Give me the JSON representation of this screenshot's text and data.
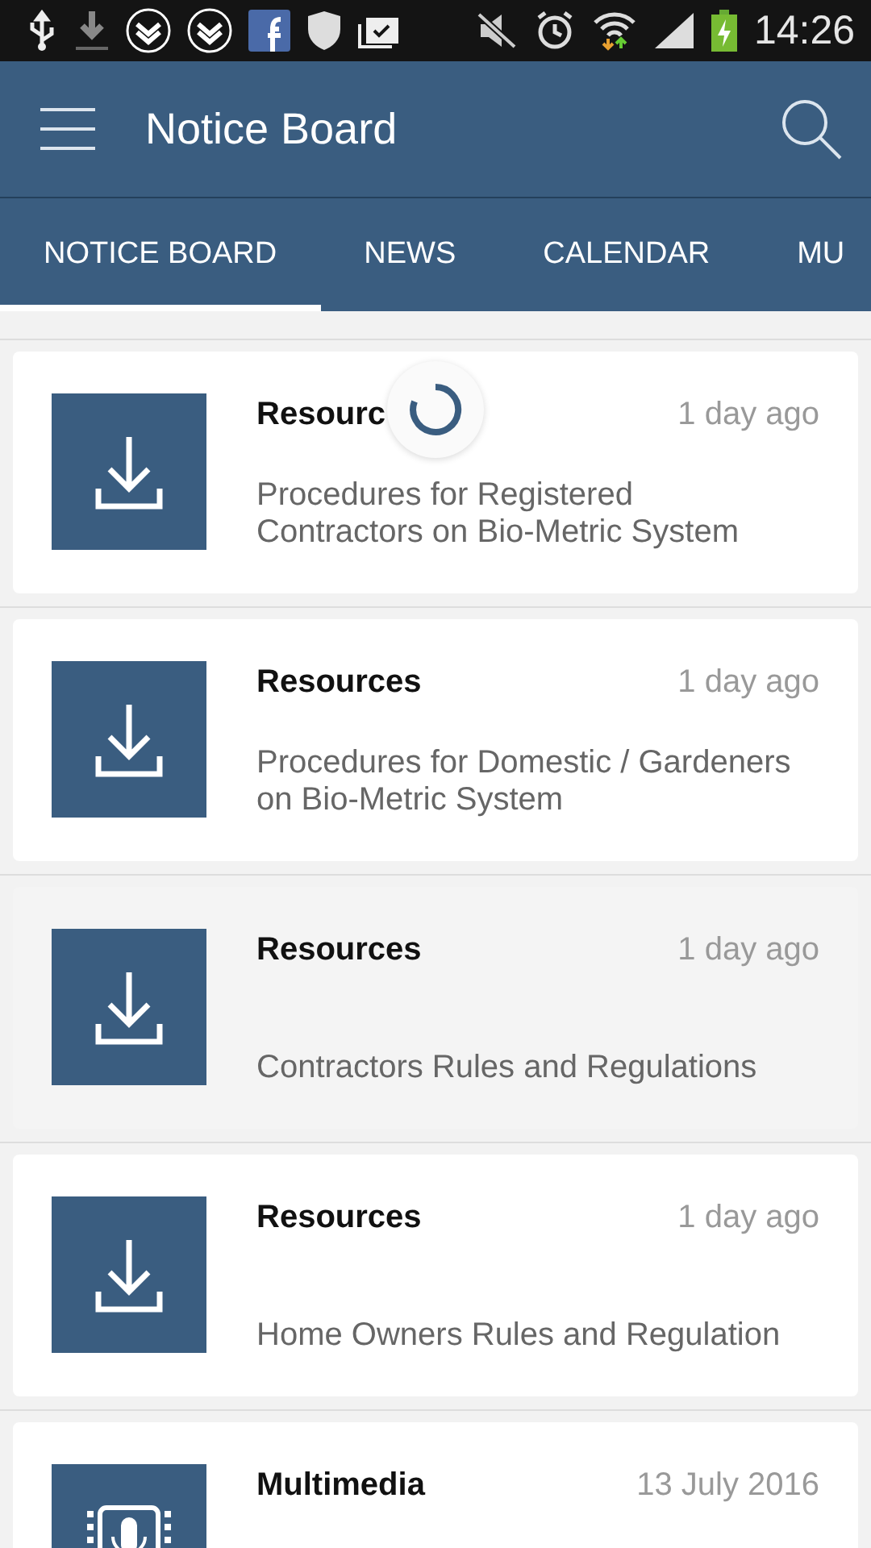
{
  "status_bar": {
    "time": "14:26"
  },
  "app_bar": {
    "title": "Notice Board"
  },
  "tabs": [
    {
      "label": "NOTICE BOARD",
      "selected": true
    },
    {
      "label": "NEWS",
      "selected": false
    },
    {
      "label": "CALENDAR",
      "selected": false
    },
    {
      "label": "MU",
      "selected": false
    }
  ],
  "items": [
    {
      "kind": "download",
      "title": "Resourc",
      "time": "1 day ago",
      "body": "Procedures for Registered Contractors on Bio-Metric System",
      "pressed": false,
      "loading": true
    },
    {
      "kind": "download",
      "title": "Resources",
      "time": "1 day ago",
      "body": "Procedures for Domestic / Gardeners on Bio-Metric System",
      "pressed": false,
      "loading": false
    },
    {
      "kind": "download",
      "title": "Resources",
      "time": "1 day ago",
      "body": "Contractors Rules and Regulations",
      "pressed": true,
      "loading": false
    },
    {
      "kind": "download",
      "title": "Resources",
      "time": "1 day ago",
      "body": "Home Owners Rules and Regulation",
      "pressed": false,
      "loading": false
    },
    {
      "kind": "media",
      "title": "Multimedia",
      "time": "13 July 2016",
      "pressed": false,
      "loading": false
    }
  ]
}
